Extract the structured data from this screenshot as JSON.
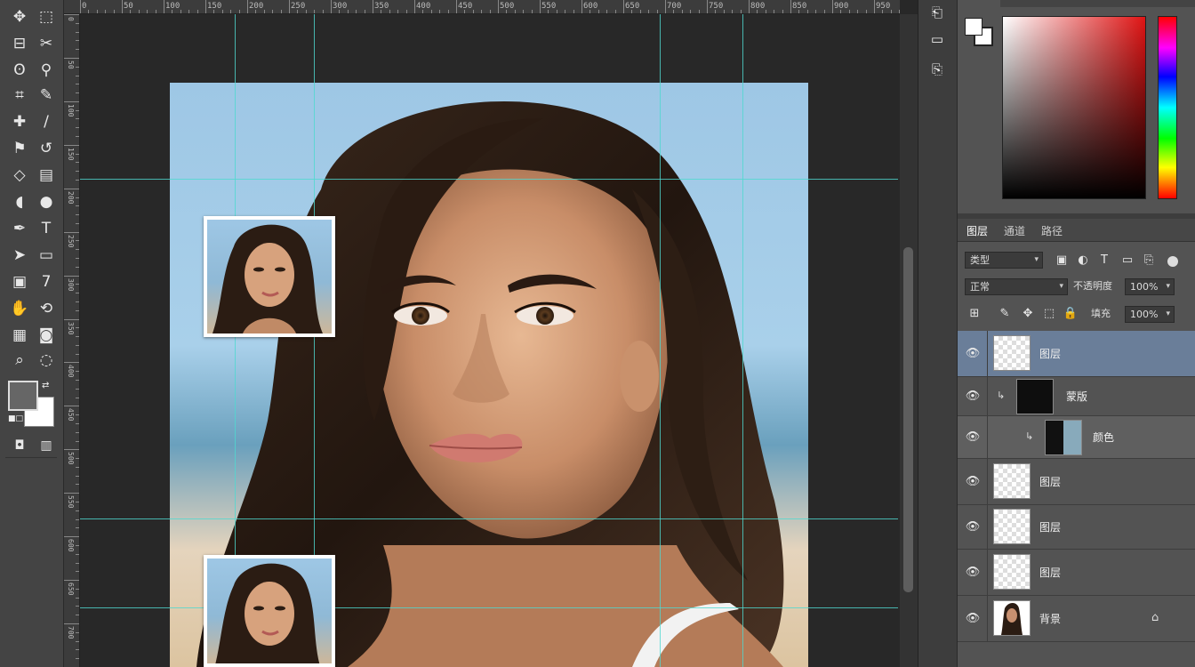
{
  "toolbar": {
    "tools": [
      {
        "id": "move",
        "icon": "move-tool-icon",
        "glyph": "✥"
      },
      {
        "id": "marquee",
        "icon": "rect-marquee-icon",
        "glyph": "⬚"
      },
      {
        "id": "lasso",
        "icon": "lasso-icon",
        "glyph": "ʘ"
      },
      {
        "id": "quick-select",
        "icon": "quick-select-icon",
        "glyph": "⚲"
      },
      {
        "id": "crop",
        "icon": "crop-icon",
        "glyph": "⌗"
      },
      {
        "id": "eyedropper",
        "icon": "eyedropper-icon",
        "glyph": "✎"
      },
      {
        "id": "spot-heal",
        "icon": "spot-heal-icon",
        "glyph": "✚"
      },
      {
        "id": "brush",
        "icon": "brush-icon",
        "glyph": "/"
      },
      {
        "id": "clone",
        "icon": "clone-stamp-icon",
        "glyph": "⚑"
      },
      {
        "id": "history-brush",
        "icon": "history-brush-icon",
        "glyph": "↺"
      },
      {
        "id": "eraser",
        "icon": "eraser-icon",
        "glyph": "◇"
      },
      {
        "id": "gradient",
        "icon": "gradient-icon",
        "glyph": "▤"
      },
      {
        "id": "blur",
        "icon": "blur-icon",
        "glyph": "◖"
      },
      {
        "id": "dodge",
        "icon": "dodge-icon",
        "glyph": "●"
      },
      {
        "id": "pen",
        "icon": "pen-tool-icon",
        "glyph": "✒"
      },
      {
        "id": "type",
        "icon": "type-tool-icon",
        "glyph": "T"
      },
      {
        "id": "path-select",
        "icon": "path-select-icon",
        "glyph": "➤"
      },
      {
        "id": "shape",
        "icon": "shape-tool-icon",
        "glyph": "▭"
      },
      {
        "id": "hand",
        "icon": "hand-tool-icon",
        "glyph": "✋"
      },
      {
        "id": "zoom",
        "icon": "zoom-tool-icon",
        "glyph": "🔍"
      }
    ],
    "foreground_color": "#666666",
    "background_color": "#ffffff"
  },
  "ruler": {
    "top_labels": [
      "0",
      "50",
      "100",
      "150",
      "200",
      "250",
      "300",
      "350",
      "400",
      "450",
      "500",
      "550",
      "600",
      "650",
      "700",
      "750",
      "800",
      "850",
      "900",
      "950"
    ],
    "left_labels": [
      "0",
      "50",
      "100",
      "150",
      "200",
      "250",
      "300",
      "350",
      "400",
      "450",
      "500",
      "550",
      "600",
      "650",
      "700"
    ]
  },
  "colors": {
    "guide": "#4fd8d0",
    "selection_highlight": "#6a7e99"
  },
  "side_icons": [
    "history-icon",
    "actions-icon",
    "properties-icon"
  ],
  "layers_panel": {
    "tabs": [
      "图层",
      "通道",
      "路径"
    ],
    "filter_kind": "类型",
    "blend_mode": "正常",
    "opacity_label": "不透明度",
    "opacity_value": "100%",
    "lock_label": "锁定",
    "fill_label": "填充",
    "fill_value": "100%",
    "layers": [
      {
        "name": "图层",
        "kind": "blank",
        "selected": true
      },
      {
        "name": "蒙版",
        "kind": "mask",
        "selected": false
      },
      {
        "name": "颜色",
        "kind": "photo",
        "selected": false
      },
      {
        "name": "图层",
        "kind": "blank",
        "selected": false
      },
      {
        "name": "图层",
        "kind": "blank",
        "selected": false
      },
      {
        "name": "图层",
        "kind": "blank",
        "selected": false
      },
      {
        "name": "背景",
        "kind": "portrait",
        "selected": false
      }
    ]
  }
}
